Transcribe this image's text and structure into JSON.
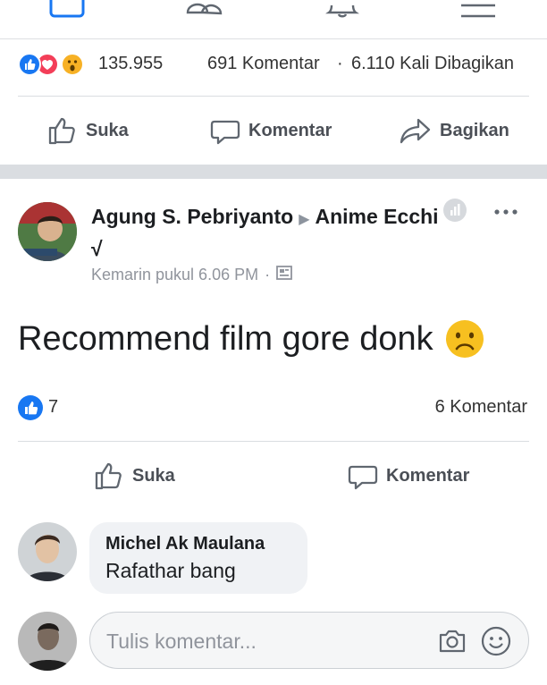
{
  "nav": {
    "icons": [
      "home-icon",
      "friends-icon",
      "notifications-icon",
      "menu-icon"
    ]
  },
  "post1": {
    "reaction_icons": [
      "like-icon",
      "love-icon",
      "wow-icon"
    ],
    "reaction_count": "135.955",
    "comment_count": "691 Komentar",
    "separator": "·",
    "share_count": "6.110 Kali Dibagikan",
    "actions": {
      "like": "Suka",
      "comment": "Komentar",
      "share": "Bagikan"
    }
  },
  "post2": {
    "author": "Agung S. Pebriyanto",
    "group": "Anime Ecchi √",
    "timestamp": "Kemarin pukul 6.06 PM",
    "meta_separator": "·",
    "text": "Recommend film gore donk",
    "emoji": "sad-face-emoji",
    "like_count": "7",
    "comment_count": "6 Komentar",
    "actions": {
      "like": "Suka",
      "comment": "Komentar"
    }
  },
  "comment": {
    "author": "Michel Ak Maulana",
    "text": "Rafathar bang"
  },
  "composer": {
    "placeholder": "Tulis komentar..."
  },
  "colors": {
    "accent": "#1877f2",
    "love": "#f33e58",
    "wow": "#f7b125",
    "divider": "#dadde1"
  }
}
